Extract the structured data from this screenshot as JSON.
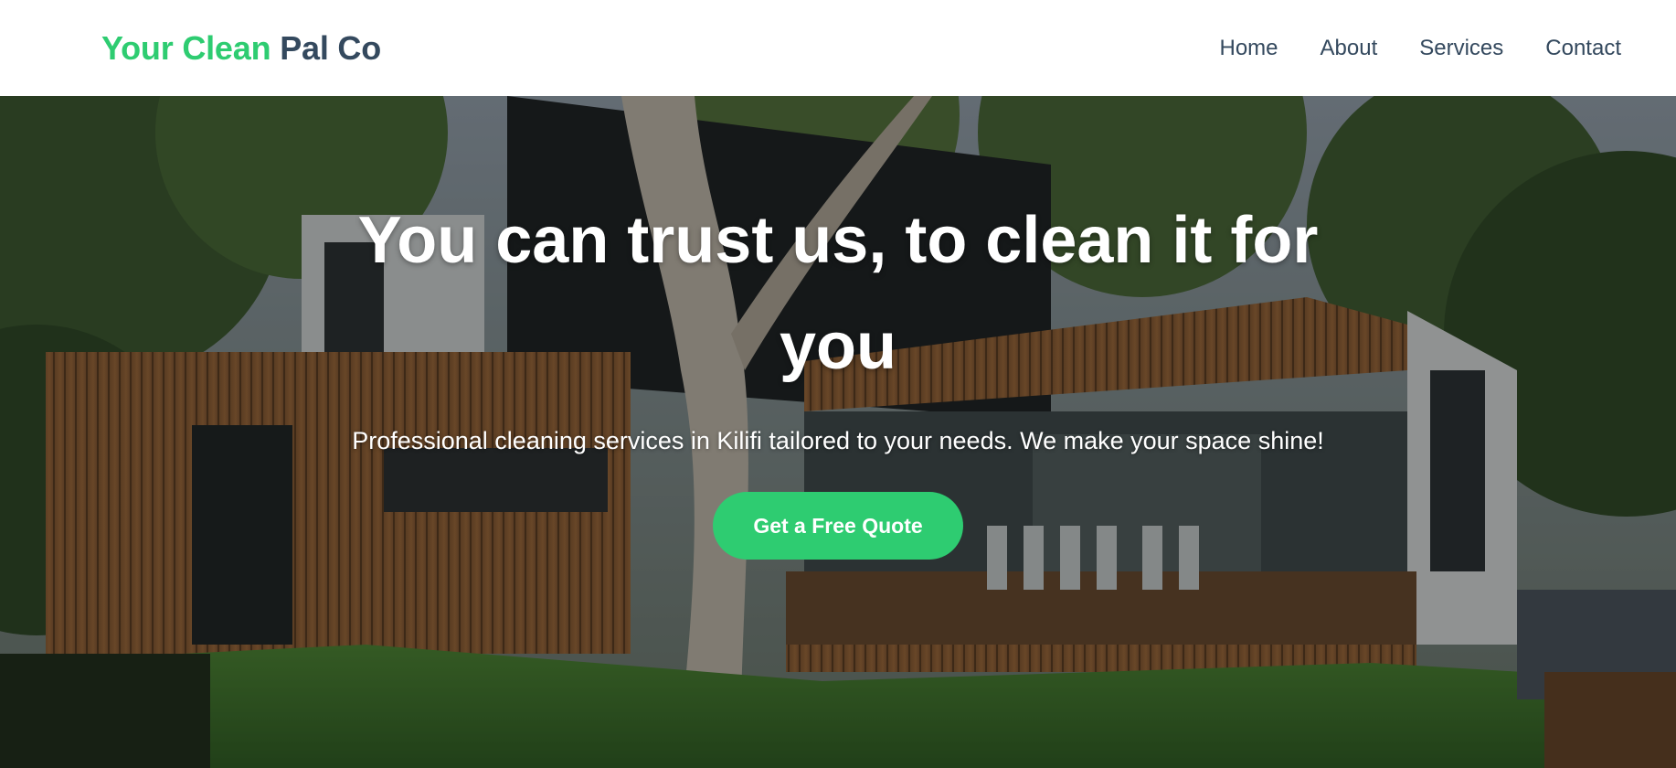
{
  "logo": {
    "accent_text": "Your Clean",
    "rest_text": "Pal Co"
  },
  "nav": {
    "items": [
      {
        "label": "Home"
      },
      {
        "label": "About"
      },
      {
        "label": "Services"
      },
      {
        "label": "Contact"
      }
    ]
  },
  "hero": {
    "title": "You can trust us, to clean it for you",
    "subtitle": "Professional cleaning services in Kilifi tailored to your needs. We make your space shine!",
    "cta_label": "Get a Free Quote"
  },
  "colors": {
    "accent": "#2ecc71",
    "text_dark": "#34495e",
    "hero_text": "#ffffff"
  }
}
